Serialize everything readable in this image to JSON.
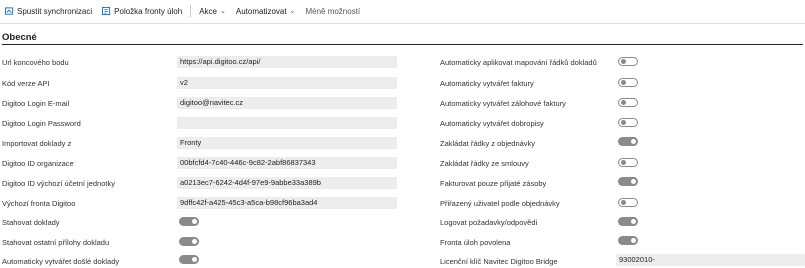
{
  "toolbar": {
    "sync_label": "Spustit synchronizaci",
    "queue_label": "Položka fronty úloh",
    "actions_label": "Akce",
    "automate_label": "Automatizovat",
    "less_label": "Méně možností"
  },
  "section": {
    "title": "Obecné"
  },
  "left_fields": [
    {
      "label": "Url koncového bodu",
      "value": "https://api.digitoo.cz/api/"
    },
    {
      "label": "Kód verze API",
      "value": "v2"
    },
    {
      "label": "Digitoo Login E-mail",
      "value": "digitoo@navitec.cz"
    },
    {
      "label": "Digitoo Login Password",
      "value": ""
    },
    {
      "label": "Importovat doklady z",
      "value": "Fronty"
    },
    {
      "label": "Digitoo ID organizace",
      "value": "00bfcfd4-7c40-446c-9c82-2abf86837343"
    },
    {
      "label": "Digitoo ID výchozí účetní jednotky",
      "value": "a0213ec7-6242-4d4f-97e9-9abbe33a389b"
    },
    {
      "label": "Výchozí fronta Digitoo",
      "value": "9dffc42f-a425-45c3-a5ca-b98cf96ba3ad4"
    }
  ],
  "left_toggles": [
    {
      "label": "Stahovat doklady",
      "on": true
    },
    {
      "label": "Stahovat ostatní přílohy dokladu",
      "on": true
    },
    {
      "label": "Automaticky vytvářet došlé doklady",
      "on": true
    }
  ],
  "right_toggles": [
    {
      "label": "Automaticky aplikovat mapování řádků dokladů",
      "on": false
    },
    {
      "label": "Automaticky vytvářet faktury",
      "on": false
    },
    {
      "label": "Automaticky vytvářet zálohové faktury",
      "on": false
    },
    {
      "label": "Automaticky vytvářet dobropisy",
      "on": false
    },
    {
      "label": "Zakládat řádky z objednávky",
      "on": true
    },
    {
      "label": "Zakládat řádky ze smlouvy",
      "on": false
    },
    {
      "label": "Fakturovat pouze přijaté zásoby",
      "on": true
    },
    {
      "label": "Přiřazený uživatel podle objednávky",
      "on": false
    },
    {
      "label": "Logovat požadavky/odpovědi",
      "on": true
    },
    {
      "label": "Fronta úloh povolena",
      "on": true
    }
  ],
  "license": {
    "label": "Licenční klíč Navitec Digitoo Bridge",
    "value": "93002010-"
  },
  "colors": {
    "toggle_on": "#8a8a8a",
    "accent": "#0f6cbd"
  }
}
